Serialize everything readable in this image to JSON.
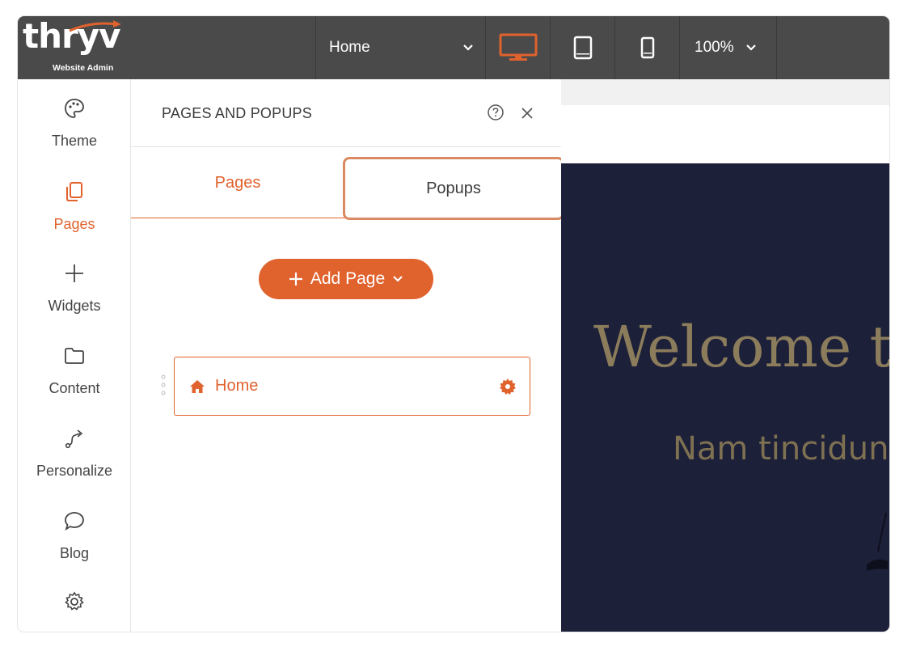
{
  "brand": {
    "logo_text": "thryv",
    "subtitle": "Website Admin"
  },
  "toolbar": {
    "page_select": "Home",
    "devices": [
      {
        "name": "desktop-icon",
        "active": true
      },
      {
        "name": "tablet-icon",
        "active": false
      },
      {
        "name": "mobile-icon",
        "active": false
      }
    ],
    "zoom": "100%"
  },
  "nav": {
    "items": [
      {
        "label": "Theme",
        "icon": "palette-icon"
      },
      {
        "label": "Pages",
        "icon": "pages-icon",
        "active": true
      },
      {
        "label": "Widgets",
        "icon": "plus-icon"
      },
      {
        "label": "Content",
        "icon": "folder-icon"
      },
      {
        "label": "Personalize",
        "icon": "route-icon"
      },
      {
        "label": "Blog",
        "icon": "chat-bubble-icon"
      },
      {
        "label": "",
        "icon": "gear-icon"
      }
    ]
  },
  "panel": {
    "title": "PAGES AND POPUPS",
    "tabs": [
      "Pages",
      "Popups"
    ],
    "add_button": "Add Page",
    "pages": [
      {
        "label": "Home"
      }
    ]
  },
  "preview": {
    "heading": "Welcome to",
    "subheading": "Nam tincidunt"
  },
  "colors": {
    "accent": "#e0622d",
    "topbar": "#4a4a4a",
    "hero_bg": "#1d2039",
    "hero_text": "#8b7c5c"
  }
}
